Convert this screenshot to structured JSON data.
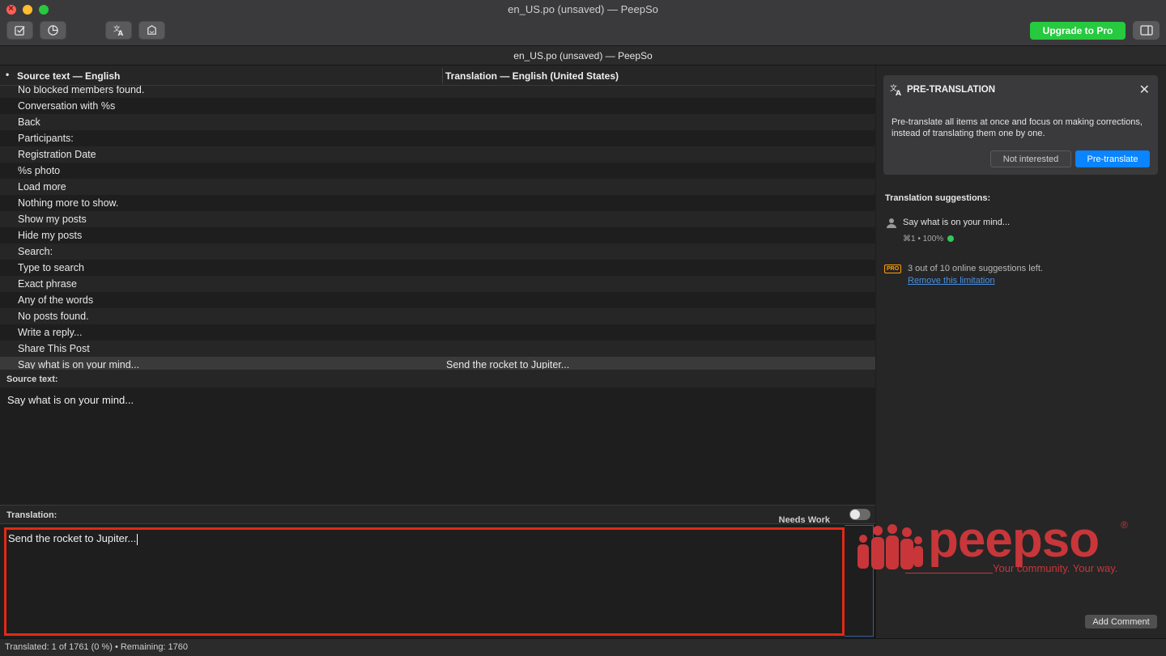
{
  "window": {
    "title": "en_US.po (unsaved) — PeepSo",
    "doc_tab": "en_US.po (unsaved) — PeepSo"
  },
  "toolbar": {
    "validate_icon": "checkbox-icon",
    "stats_icon": "pie-chart-icon",
    "pretranslate_icon": "translate-icon",
    "update_icon": "update-icon",
    "upgrade_label": "Upgrade to Pro",
    "sidebar_icon": "sidebar-icon"
  },
  "columns": {
    "bullet": "•",
    "source": "Source text — English",
    "translation": "Translation — English (United States)"
  },
  "rows": [
    {
      "source": "No blocked members found.",
      "translation": ""
    },
    {
      "source": "Conversation with %s",
      "translation": ""
    },
    {
      "source": "Back",
      "translation": ""
    },
    {
      "source": "Participants:",
      "translation": ""
    },
    {
      "source": "Registration Date",
      "translation": ""
    },
    {
      "source": "%s photo",
      "translation": ""
    },
    {
      "source": "Load more",
      "translation": ""
    },
    {
      "source": "Nothing more to show.",
      "translation": ""
    },
    {
      "source": "Show my posts",
      "translation": ""
    },
    {
      "source": "Hide my posts",
      "translation": ""
    },
    {
      "source": "Search:",
      "translation": ""
    },
    {
      "source": "Type to search",
      "translation": ""
    },
    {
      "source": "Exact phrase",
      "translation": ""
    },
    {
      "source": "Any of the words",
      "translation": ""
    },
    {
      "source": "No posts found.",
      "translation": ""
    },
    {
      "source": "Write a reply...",
      "translation": ""
    },
    {
      "source": "Share This Post",
      "translation": ""
    },
    {
      "source": "Say what is on your mind...",
      "translation": "Send the rocket to Jupiter..."
    }
  ],
  "editor": {
    "source_label": "Source text:",
    "source_text": "Say what is on your mind...",
    "translation_label": "Translation:",
    "needs_work_label": "Needs Work",
    "translation_text": "Send the rocket to Jupiter..."
  },
  "sidebar": {
    "pretranslation": {
      "title": "PRE-TRANSLATION",
      "description": "Pre-translate all items at once and focus on making corrections, instead of translating them one by one.",
      "not_interested": "Not interested",
      "pretranslate": "Pre-translate"
    },
    "suggestions_title": "Translation suggestions:",
    "suggestion_text": "Say what is on your mind...",
    "suggestion_meta": "⌘1 • 100%",
    "pro_badge": "PRO",
    "pro_text": "3 out of 10 online suggestions left.",
    "pro_link": "Remove this limitation",
    "add_comment": "Add Comment"
  },
  "logo": {
    "text": "peepso",
    "tagline": "Your community. Your way."
  },
  "status": {
    "text": "Translated: 1 of 1761 (0 %)  •  Remaining: 1760"
  },
  "colors": {
    "accent_blue": "#0a84ff",
    "upgrade_green": "#27c93f",
    "highlight_red": "#e02a17",
    "brand_red": "#c8363a"
  }
}
